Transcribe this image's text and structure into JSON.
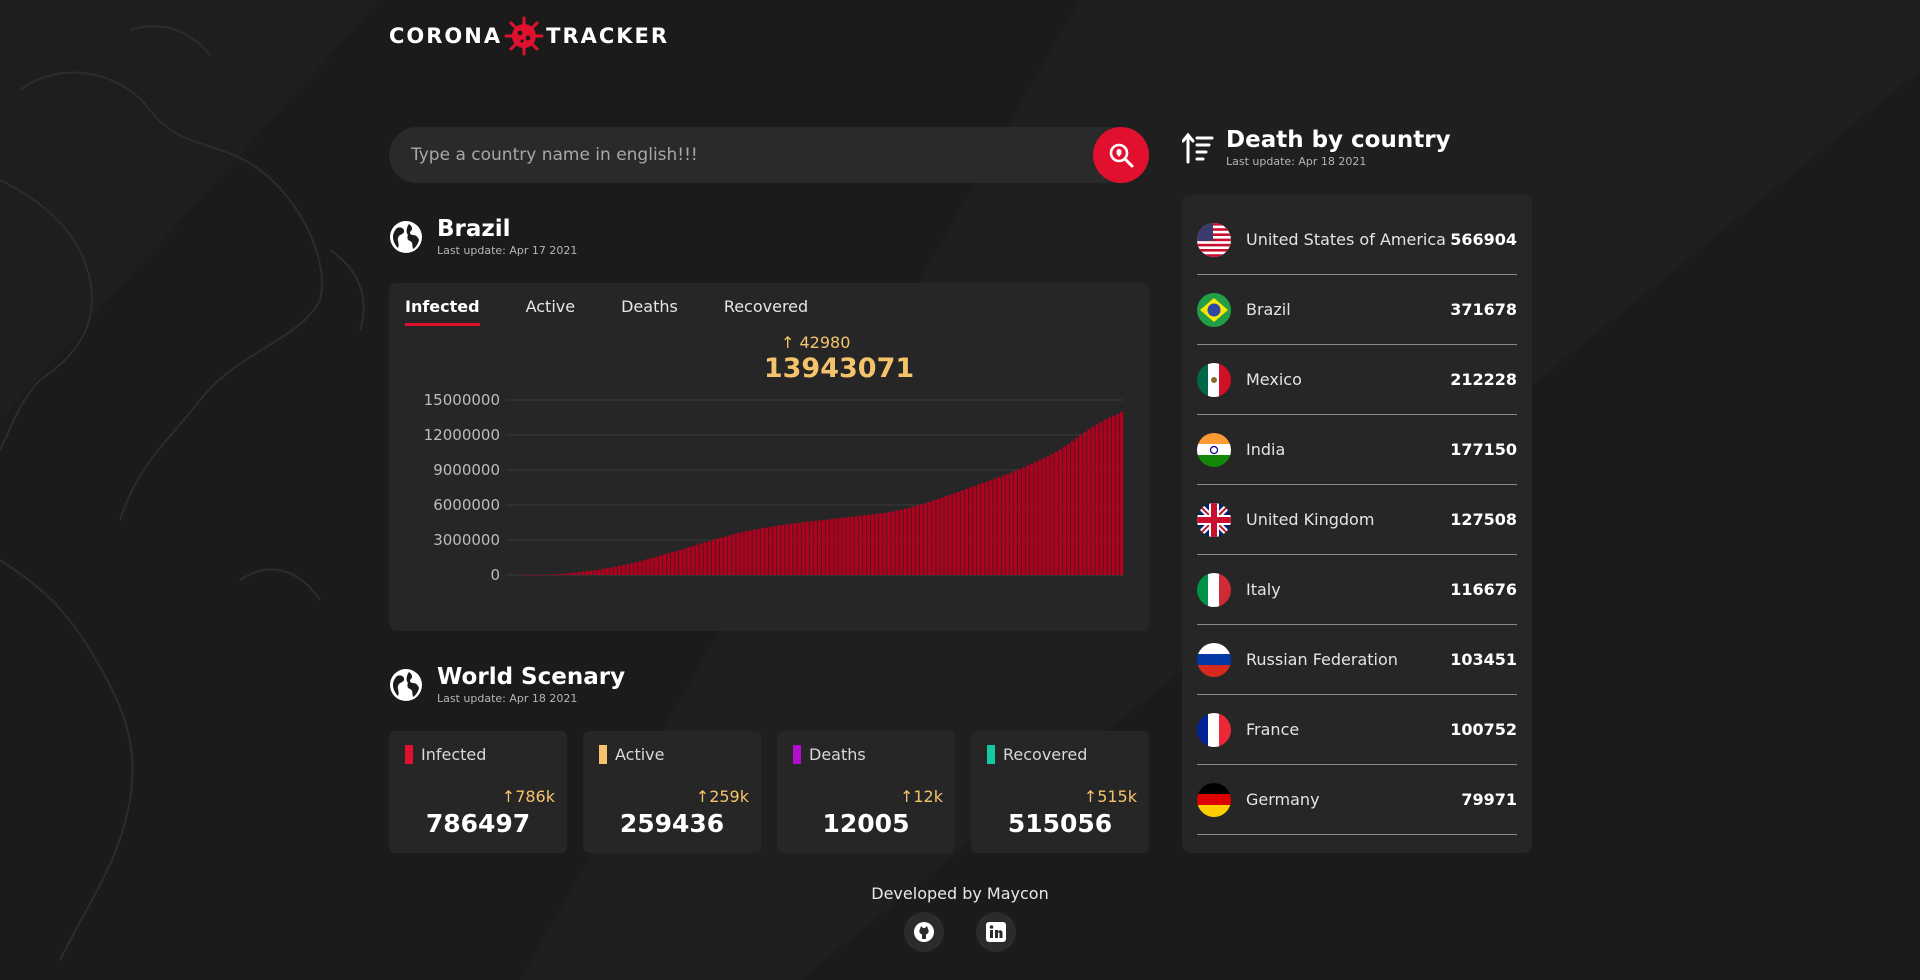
{
  "logo": {
    "left": "CORONA",
    "right": "TRACKER"
  },
  "search": {
    "placeholder": "Type a country name in english!!!"
  },
  "country_section": {
    "title": "Brazil",
    "last_update": "Last update: Apr 17 2021"
  },
  "tabs": [
    {
      "label": "Infected",
      "active": true
    },
    {
      "label": "Active",
      "active": false
    },
    {
      "label": "Deaths",
      "active": false
    },
    {
      "label": "Recovered",
      "active": false
    }
  ],
  "country_stats": {
    "increase": "42980",
    "total": "13943071"
  },
  "chart_data": {
    "type": "bar",
    "title": "",
    "xlabel": "",
    "ylabel": "",
    "ylim": [
      0,
      15000000
    ],
    "yticks": [
      "15000000",
      "12000000",
      "9000000",
      "6000000",
      "3000000",
      "0"
    ],
    "grid": true,
    "color": "#b3001f",
    "series": [
      {
        "name": "Infected",
        "values": [
          2000,
          5000,
          9000,
          15000,
          22000,
          31000,
          43000,
          58000,
          78000,
          101000,
          130000,
          160000,
          200000,
          240000,
          285000,
          330000,
          376000,
          410000,
          460000,
          520000,
          586000,
          645000,
          710000,
          775000,
          860000,
          930000,
          1010000,
          1090000,
          1180000,
          1270000,
          1370000,
          1460000,
          1560000,
          1680000,
          1780000,
          1880000,
          1960000,
          2060000,
          2150000,
          2260000,
          2380000,
          2480000,
          2590000,
          2700000,
          2800000,
          2910000,
          3020000,
          3120000,
          3210000,
          3310000,
          3410000,
          3500000,
          3590000,
          3670000,
          3740000,
          3810000,
          3880000,
          3950000,
          4010000,
          4070000,
          4130000,
          4180000,
          4240000,
          4290000,
          4340000,
          4390000,
          4440000,
          4480000,
          4530000,
          4570000,
          4610000,
          4640000,
          4680000,
          4710000,
          4750000,
          4790000,
          4830000,
          4870000,
          4910000,
          4960000,
          5000000,
          5040000,
          5080000,
          5120000,
          5160000,
          5200000,
          5240000,
          5280000,
          5320000,
          5380000,
          5450000,
          5520000,
          5600000,
          5680000,
          5770000,
          5870000,
          5970000,
          6070000,
          6170000,
          6280000,
          6400000,
          6510000,
          6630000,
          6750000,
          6870000,
          6990000,
          7110000,
          7240000,
          7370000,
          7500000,
          7630000,
          7760000,
          7880000,
          8000000,
          8130000,
          8260000,
          8390000,
          8510000,
          8640000,
          8780000,
          8930000,
          9080000,
          9230000,
          9390000,
          9540000,
          9700000,
          9860000,
          10020000,
          10180000,
          10360000,
          10550000,
          10760000,
          10990000,
          11230000,
          11480000,
          11730000,
          11990000,
          12240000,
          12480000,
          12700000,
          12910000,
          13110000,
          13310000,
          13480000,
          13640000,
          13790000,
          13943071
        ]
      }
    ]
  },
  "world_section": {
    "title": "World Scenary",
    "last_update": "Last update: Apr 18 2021"
  },
  "world_cards": [
    {
      "label": "Infected",
      "color": "#e2102f",
      "increase": "↑786k",
      "value": "786497"
    },
    {
      "label": "Active",
      "color": "#f5c36b",
      "increase": "↑259k",
      "value": "259436"
    },
    {
      "label": "Deaths",
      "color": "#b10ecf",
      "increase": "↑12k",
      "value": "12005"
    },
    {
      "label": "Recovered",
      "color": "#13c9a1",
      "increase": "↑515k",
      "value": "515056"
    }
  ],
  "death_section": {
    "title": "Death by country",
    "last_update": "Last update: Apr 18 2021"
  },
  "death_list": [
    {
      "country": "United States of America",
      "deaths": "566904",
      "flag": "us"
    },
    {
      "country": "Brazil",
      "deaths": "371678",
      "flag": "br"
    },
    {
      "country": "Mexico",
      "deaths": "212228",
      "flag": "mx"
    },
    {
      "country": "India",
      "deaths": "177150",
      "flag": "in"
    },
    {
      "country": "United Kingdom",
      "deaths": "127508",
      "flag": "gb"
    },
    {
      "country": "Italy",
      "deaths": "116676",
      "flag": "it"
    },
    {
      "country": "Russian Federation",
      "deaths": "103451",
      "flag": "ru"
    },
    {
      "country": "France",
      "deaths": "100752",
      "flag": "fr"
    },
    {
      "country": "Germany",
      "deaths": "79971",
      "flag": "de"
    }
  ],
  "footer": {
    "text": "Developed by Maycon",
    "icons": [
      "github-icon",
      "linkedin-icon"
    ]
  },
  "colors": {
    "accent": "#e2102f",
    "highlight": "#f5c36b",
    "card": "#262626",
    "background": "#1b1b1b"
  }
}
